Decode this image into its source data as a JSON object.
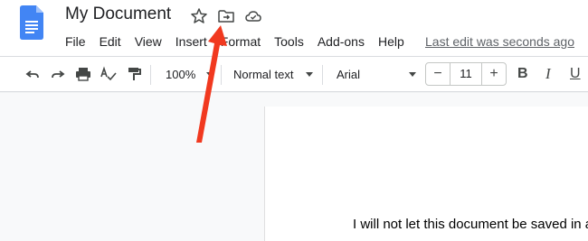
{
  "header": {
    "title": "My Document",
    "menu": [
      "File",
      "Edit",
      "View",
      "Insert",
      "Format",
      "Tools",
      "Add-ons",
      "Help"
    ],
    "last_edit": "Last edit was seconds ago",
    "icons": [
      "star-icon",
      "move-to-folder-icon",
      "cloud-status-icon"
    ]
  },
  "toolbar": {
    "zoom": "100%",
    "style": "Normal text",
    "font": "Arial",
    "font_size": "11",
    "minus": "−",
    "plus": "+",
    "bold": "B",
    "italic": "I",
    "underline": "U"
  },
  "document": {
    "text": "I will not let this document be saved in a"
  },
  "colors": {
    "docs_blue": "#4285f4",
    "arrow_red": "#f1391f"
  }
}
